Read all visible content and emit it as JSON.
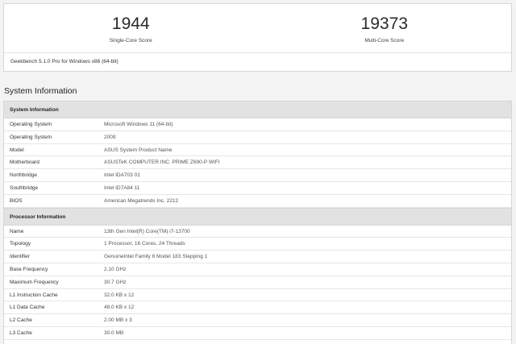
{
  "scores": {
    "single_value": "1944",
    "single_label": "Single-Core Score",
    "multi_value": "19373",
    "multi_label": "Multi-Core Score",
    "version": "Geekbench 5.1.0 Pro for Windows x86 (64-bit)"
  },
  "section_title": "System Information",
  "system": {
    "header": "System Information",
    "rows": [
      {
        "key": "Operating System",
        "value": "Microsoft Windows 11 (64-bit)"
      },
      {
        "key": "Operating System",
        "value": "2009"
      },
      {
        "key": "Model",
        "value": "ASUS System Product Name"
      },
      {
        "key": "Motherboard",
        "value": "ASUSTeK COMPUTER INC. PRIME Z690-P WIFI"
      },
      {
        "key": "Northbridge",
        "value": "Intel IDA703 01"
      },
      {
        "key": "Southbridge",
        "value": "Intel ID7A84 11"
      },
      {
        "key": "BIOS",
        "value": "American Megatrends Inc. 2212"
      }
    ]
  },
  "processor": {
    "header": "Processor Information",
    "rows": [
      {
        "key": "Name",
        "value": "13th Gen Intel(R) Core(TM) i7-13700"
      },
      {
        "key": "Topology",
        "value": "1 Processor, 16 Cores, 24 Threads"
      },
      {
        "key": "Identifier",
        "value": "GenuineIntel Family 6 Model 183 Stepping 1"
      },
      {
        "key": "Base Frequency",
        "value": "2.10 GHz"
      },
      {
        "key": "Maximum Frequency",
        "value": "30.7 GHz"
      },
      {
        "key": "L1 Instruction Cache",
        "value": "32.0 KB x 12"
      },
      {
        "key": "L1 Data Cache",
        "value": "48.0 KB x 12"
      },
      {
        "key": "L2 Cache",
        "value": "2.00 MB x 3"
      },
      {
        "key": "L3 Cache",
        "value": "30.0 MB"
      }
    ]
  }
}
